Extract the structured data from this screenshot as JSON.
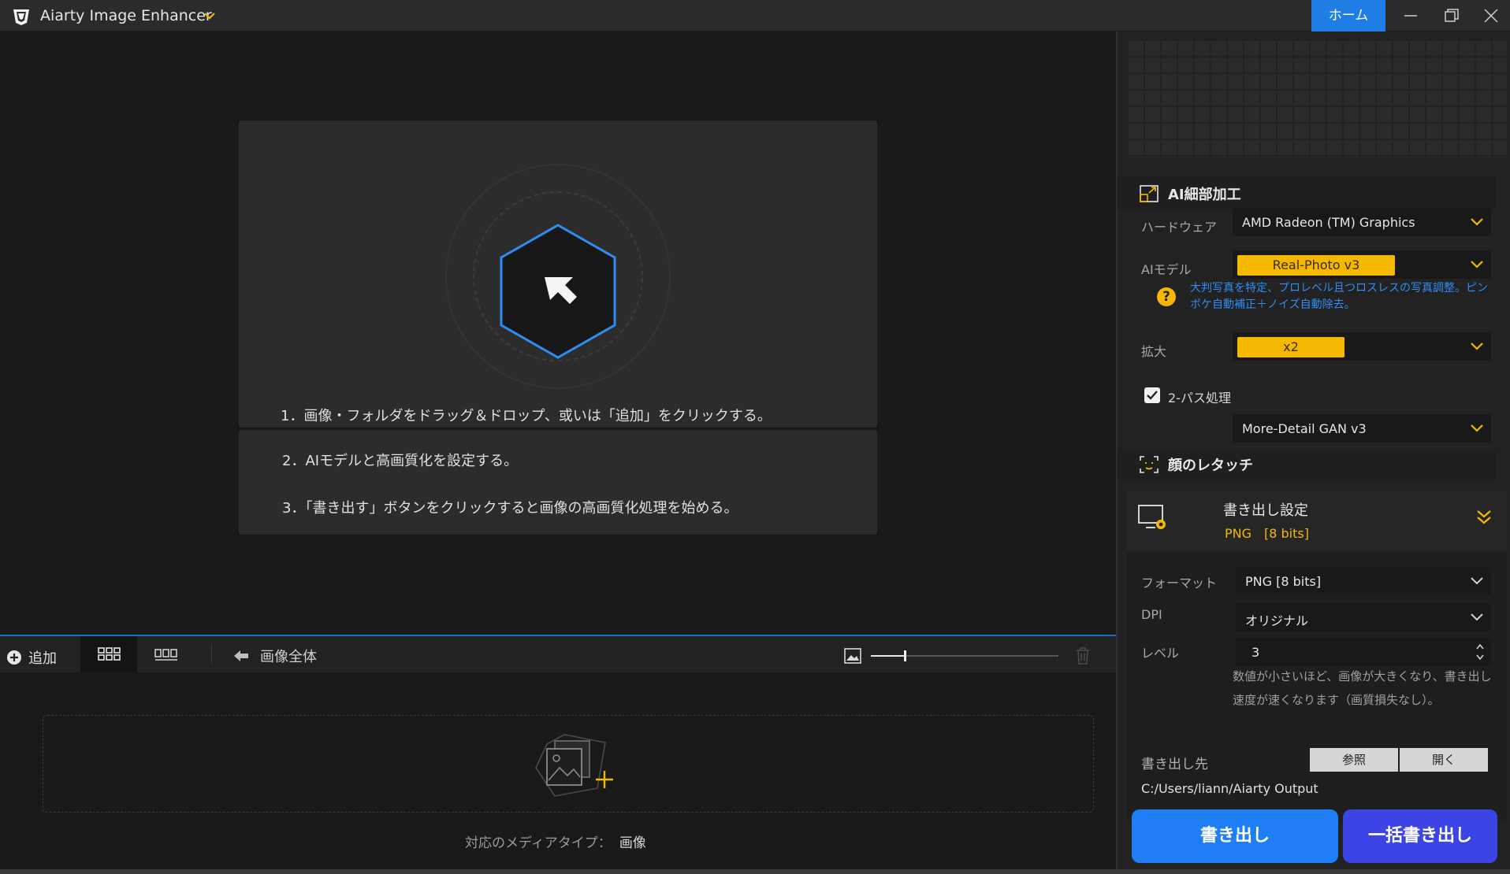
{
  "app": {
    "title": "Aiarty Image Enhancer",
    "home_label": "ホーム"
  },
  "colors": {
    "accent_blue": "#1e7ee6",
    "accent_yellow": "#f5b800",
    "export_blue": "#1f7ef5",
    "batch_export": "#3c44e6"
  },
  "icons": {
    "logo": "app-logo-icon",
    "chevron": "chevron-down-icon",
    "minimize": "minimize-icon",
    "maximize": "restore-icon",
    "close": "close-icon",
    "drop_cursor": "cursor-arrow-hex-icon",
    "add": "plus-circle-icon",
    "image_toggle": "image-icon",
    "trash": "trash-icon",
    "add_image": "add-image-icon",
    "help": "question-icon",
    "ai_detail": "resize-icon",
    "face": "face-scan-icon",
    "export_settings": "monitor-gear-icon"
  },
  "main": {
    "steps": [
      "1．画像・フォルダをドラッグ＆ドロップ、或いは「追加」をクリックする。",
      "2．AIモデルと高画質化を設定する。",
      "3．「書き出す」ボタンをクリックすると画像の高画質化処理を始める。"
    ]
  },
  "toolbar": {
    "add_label": "追加",
    "fit_label": "画像全体",
    "zoom_fraction": 0.18
  },
  "thumbs": {
    "media_label": "対応のメディアタイプ：",
    "media_value": "画像"
  },
  "panel": {
    "ai_detail_title": "AI細部加工",
    "hardware_label": "ハードウェア",
    "hardware_value": "AMD Radeon (TM) Graphics",
    "ai_model_label": "AIモデル",
    "ai_model_value": "Real-Photo  v3",
    "ai_model_help": "大判写真を特定、プロレベル且つロスレスの写真調整。ピンボケ自動補正＋ノイズ自動除去。",
    "scale_label": "拡大",
    "scale_value": "x2",
    "two_pass_label": "2-パス処理",
    "two_pass_checked": true,
    "two_pass_model": "More-Detail GAN  v3",
    "face_title": "顔のレタッチ",
    "export_title": "書き出し設定",
    "export_summary": "PNG　[8 bits]",
    "format_label": "フォーマット",
    "format_value": "PNG   [8 bits]",
    "dpi_label": "DPI",
    "dpi_value": "オリジナル",
    "level_label": "レベル",
    "level_value": "3",
    "level_note": "数値が小さいほど、画像が大きくなり、書き出し速度が速くなります（画質損失なし）。",
    "output_label": "書き出し先",
    "browse_label": "参照",
    "open_label": "開く",
    "output_path": "C:/Users/liann/Aiarty Output",
    "export_btn": "書き出し",
    "batch_export_btn": "一括書き出し"
  }
}
